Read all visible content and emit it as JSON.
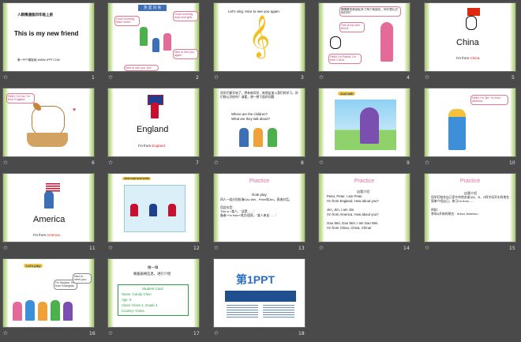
{
  "slides": [
    {
      "number": "1",
      "title": "This is my new friend",
      "subtitle": "人教精通版四年级上册",
      "footer": "第一PPT模板网-WWW.1PPT.COM"
    },
    {
      "number": "2",
      "header": "热 室 词 语",
      "bubble1": "Good morning, Miss Green.",
      "bubble2": "Good morning, boys and girls.",
      "bubble3": "Nice to see you, again.",
      "bubble4": "Nice to see you, too!"
    },
    {
      "number": "3",
      "text": "Let's sing: Nice to see you again."
    },
    {
      "number": "4",
      "prompt": "猜猜看的新朋友来了两个新朋友，你们想认识他们吗？",
      "bubble1": "This is my new friend.",
      "bubble2": "Hello! I'm Panda. I'm from China."
    },
    {
      "number": "5",
      "country": "China",
      "line": "I'm from ",
      "place": "China",
      "end": "."
    },
    {
      "number": "6",
      "bubble": "Hello! I'm Cat. I'm from England."
    },
    {
      "number": "7",
      "country": "England",
      "line": "I'm from ",
      "place": "England",
      "end": "."
    },
    {
      "number": "8",
      "intro": "同学们都开始了，将有新同学、新朋友加入我们的学习，你们想认识他吗？请看，想一想下面的问题",
      "q1": "Where are the children?",
      "q2": "What are they talk about?"
    },
    {
      "number": "9",
      "label": "Just talk"
    },
    {
      "number": "10",
      "bubble": "Hello! I'm Jim. I'm from America."
    },
    {
      "number": "11",
      "country": "America",
      "line": "I'm from ",
      "place": "America",
      "end": "."
    },
    {
      "number": "12",
      "label": "Just read and write"
    },
    {
      "number": "13",
      "heading": "Practice",
      "subhead": "Role play",
      "lines": [
        "四人一组分别扮演Gao Wei、Peter和Jim，表演对话。",
        "用此句型：",
        "This is +某人，\"这是……\"",
        "备者+I'm from+地点/国家，\"某人来自……\""
      ]
    },
    {
      "number": "14",
      "heading": "Practice",
      "subhead": "自我介绍",
      "lines": [
        "Peter, Peter, I am Peter.",
        "I'm from England. How about you?",
        "",
        "Jim, Jim, I am Jim.",
        "I'm from America. How about you?",
        "",
        "Gao Wei, Gao Wei, I am Gao Wei.",
        "I'm from China, China, China!"
      ]
    },
    {
      "number": "15",
      "heading": "Practice",
      "subhead": "自我介绍",
      "lines": [
        "同学们结合自己家乡的地名或以A、B、C四字母开头的地名简单介绍自己，练习I'm from......",
        "例如：",
        "李母A开始的地名：Anhui, America..."
      ]
    },
    {
      "number": "16",
      "label": "Let's play",
      "bubble1": "I'm Jiaojiao. I'm from Shanghai.",
      "bubble2": "Nice to meet you."
    },
    {
      "number": "17",
      "heading": "做一做",
      "subhead": "根据表格信息，进行介绍",
      "card_title": "Student Card",
      "card_lines": [
        "Name: Candy Chen",
        "Age: 9",
        "Class: Class 1, Grade 4",
        "Country: China"
      ]
    },
    {
      "number": "18",
      "logo": "第1PPT"
    }
  ],
  "colors": {
    "background": "#4a4a4a",
    "accent_pink": "#e96aa5",
    "card_green": "#2e9e49"
  }
}
